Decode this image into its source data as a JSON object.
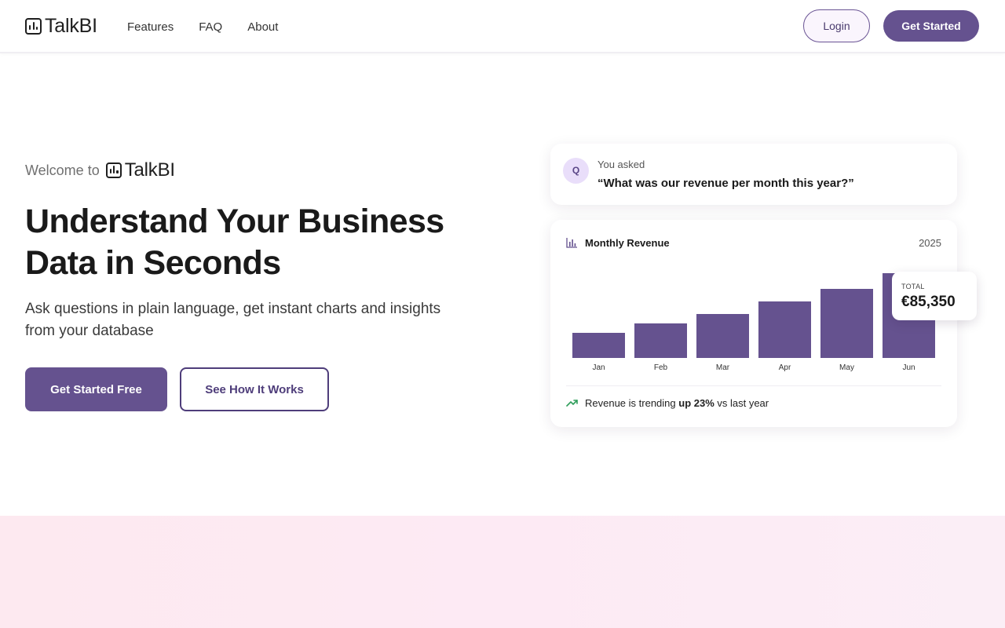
{
  "header": {
    "logo_text": "TalkBI",
    "nav": [
      "Features",
      "FAQ",
      "About"
    ],
    "login_label": "Login",
    "get_started_label": "Get Started"
  },
  "hero": {
    "welcome_text": "Welcome to",
    "welcome_logo_text": "TalkBI",
    "title": "Understand Your Business Data in Seconds",
    "subtitle": "Ask questions in plain language, get instant charts and insights from your database",
    "primary_cta": "Get Started Free",
    "secondary_cta": "See How It Works"
  },
  "question_card": {
    "avatar": "Q",
    "label": "You asked",
    "question": "“What was our revenue per month this year?”"
  },
  "chart_card": {
    "icon": "bar-chart-icon",
    "title": "Monthly Revenue",
    "year": "2025",
    "total_label": "TOTAL",
    "total_value": "€85,350",
    "trend_icon": "trending-up-icon",
    "trend_prefix": "Revenue is trending ",
    "trend_highlight": "up 23%",
    "trend_suffix": " vs last year"
  },
  "colors": {
    "accent": "#65528f",
    "accent_dark": "#4e3d7a",
    "trend_green": "#2f9e5b",
    "pink_section": "#fde9f0"
  },
  "chart_data": {
    "type": "bar",
    "categories": [
      "Jan",
      "Feb",
      "Mar",
      "Apr",
      "May",
      "Jun"
    ],
    "values": [
      32,
      44,
      56,
      72,
      88,
      108
    ],
    "ylim": [
      0,
      108
    ],
    "title": "Monthly Revenue",
    "xlabel": "",
    "ylabel": "",
    "grid": false,
    "legend": "none",
    "color": "#65528f"
  }
}
